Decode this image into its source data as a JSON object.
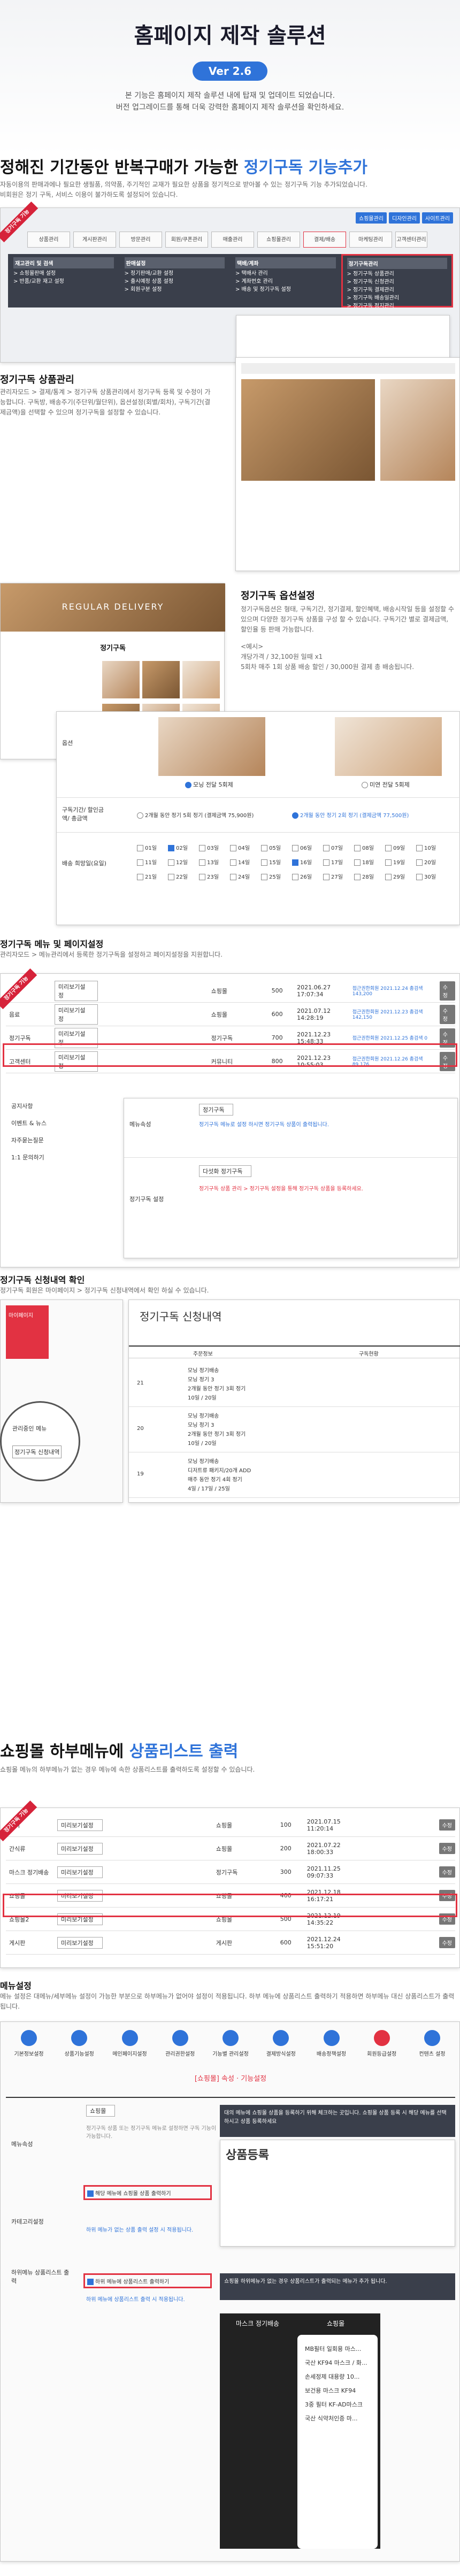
{
  "header": {
    "title": "홈페이지 제작 솔루션",
    "version": "Ver 2.6",
    "intro_lines": [
      "본 기능은 홈페이지 제작 솔루션 내에 탑재 및 업데이트 되었습니다.",
      "버전 업그레이드를 통해 더욱 강력한 홈페이지 제작 솔루션을 확인하세요."
    ]
  },
  "s1": {
    "title_a": "정해진 기간동안 반복구매가 가능한 ",
    "title_b": "정기구독 기능추가",
    "desc1": "자동이용의 판매과에나 필요한 생필품, 의약품, 주기적인 교재가 필요한 상품을 정기적으로 받아볼 수 있는 정기구독 기능 추가되었습니다.",
    "desc2": "비회원은 정기 구독, 서비스 이용이 불가하도록 설정되어 있습니다.",
    "top_links": [
      "쇼핑몰관리",
      "디자인관리",
      "사이트관리"
    ],
    "tabs": [
      "상품관리",
      "게시판관리",
      "방문관리",
      "회원/쿠폰관리",
      "매출관리",
      "쇼핑몰관리",
      "결제/배송",
      "마케팅관리",
      "고객센터관리"
    ],
    "menu_cols": [
      {
        "head": "재고관리 및 검색",
        "items": [
          "> 쇼핑몰판매 설정",
          "> 반품/교환 재고 설정"
        ]
      },
      {
        "head": "판매설정",
        "items": [
          "> 정기판매/교환 설정",
          "> 출시예정 상품 설정",
          "> 회원구분 설정"
        ]
      },
      {
        "head": "택배/계좌",
        "items": [
          "> 택배사 관리",
          "> 계좌번호 관리",
          "> 배송 및 정기구독 설정"
        ]
      },
      {
        "head": "정기구독관리",
        "items": [
          "> 정기구독 상품관리",
          "> 정기구독 신청관리",
          "> 정기구독 결제관리",
          "> 정기구독 배송일관리",
          "> 정기구독 정지관리"
        ]
      }
    ],
    "badge": "정기구독 기능",
    "manage_title": "정기구독 상품관리",
    "manage_desc": "관리자모드 > 결제/통계 > 정기구독 상품관리에서 정기구독 등록 및 수정이 가능합니다. 구독방, 배송주기(주단위/월단위), 옵션설정(회별/회차), 구독기간(결제금액)을 선택할 수 있으며 정기구독을 설정할 수 있습니다.",
    "banner_text": "REGULAR DELIVERY",
    "screenshot_title": "정기구독",
    "opt_title": "정기구독 옵션설정",
    "opt_desc": "정기구독옵션은 형태, 구독기간, 정기결제, 할인혜택, 배송시작일 등을 설정할 수 있으며 다양한 정기구독 상품을 구성 할 수 있습니다. 구독기간 별로 결제금액, 할인율 등 판매 가능합니다.",
    "opt_example_h": "<예시>",
    "opt_example_1": "개당가격 / 32,100원 일때 x1",
    "opt_example_2": "5회차 매주 1회 상품 배송 할인 / 30,000원 결제 총 배송됩니다.",
    "option_label": "옵션",
    "option_a": "모닝 전달 5회제",
    "option_b": "미연 전달 5회제",
    "period_label": "구독기간/ 할인금액/ 총금액",
    "period_a": "2개월 동안 정기 5회 정기 (결제금액 75,900원)",
    "period_b": "2개월 동안 정기 2회 정기 (결제금액 77,500원)",
    "ship_label": "배송 희망일(요일)",
    "days": [
      "01일",
      "02일",
      "03일",
      "04일",
      "05일",
      "06일",
      "07일",
      "08일",
      "09일",
      "10일",
      "11일",
      "12일",
      "13일",
      "14일",
      "15일",
      "16일",
      "17일",
      "18일",
      "19일",
      "20일",
      "21일",
      "22일",
      "23일",
      "24일",
      "25일",
      "26일",
      "27일",
      "28일",
      "29일",
      "30일"
    ]
  },
  "s2": {
    "title": "정기구독 메뉴 및 페이지설정",
    "desc": "관리자모드 > 메뉴관리에서 등록한 정기구독을 설정하고 페이지설정을 지원합니다.",
    "rows": [
      {
        "name": "상품",
        "type": "쇼핑몰",
        "code": "500",
        "date": "2021.06.27 17:07:34",
        "status": "접근권한회원 2021.12.24 총검색 143,200"
      },
      {
        "name": "음료",
        "type": "쇼핑몰",
        "code": "600",
        "date": "2021.07.12 14:28:19",
        "status": "접근권한회원 2021.12.23 총검색 142,150"
      },
      {
        "name": "정기구독",
        "type": "정기구독",
        "code": "700",
        "date": "2021.12.23 15:48:33",
        "status": "접근권한회원 2021.12.25 총검색 0"
      },
      {
        "name": "고객센터",
        "type": "커뮤니티",
        "code": "800",
        "date": "2021.12.23 10:55:03",
        "status": "접근권한회원 2021.12.26 총검색 89,176"
      }
    ],
    "sub_rows": [
      "공지사항",
      "이벤트 & 뉴스",
      "자주묻는질문",
      "1:1 문의하기"
    ],
    "select_label": "미리보기설정",
    "edit_btn": "수정",
    "menu_attr": "메뉴속성",
    "menu_attr_val": "정기구독",
    "menu_note": "정기구독 메뉴로 설정 하시면 정기구독 상품이 출력됩니다.",
    "sub_setting": "정기구독 설정",
    "sub_select": "다섯화 정기구독",
    "sub_note": "정기구독 상품 관리 > 정기구독 설정을 통해 정기구독 상품을 등록하세요."
  },
  "s3": {
    "title": "정기구독 신청내역 확인",
    "desc": "정기구독 회원은 마이페이지 > 정기구독 신청내역에서 확인 하실 수 있습니다.",
    "mypage": "마이페이지",
    "mypage_items": [
      "관리중인 메뉴",
      "정기구독 신청내역"
    ],
    "list_title": "정기구독 신청내역",
    "col_info": "주문정보",
    "col_status": "구독현황",
    "orders": [
      {
        "no": "21",
        "name": "모닝 정기배송",
        "opt": "모닝 정기 3",
        "period": "2개월 동안 정기 3회 정기",
        "day": "10일 / 20일"
      },
      {
        "no": "20",
        "name": "모닝 정기배송",
        "opt": "모닝 정기 3",
        "period": "2개월 동안 정기 3회 정기",
        "day": "10일 / 20일"
      },
      {
        "no": "19",
        "name": "모닝 정기배송",
        "opt": "디저트류 패키지/20개 ADD",
        "period": "매주 동안 정기 4회 정기",
        "day": "4일 / 17일 / 25일"
      }
    ]
  },
  "s4": {
    "title_a": "쇼핑몰 하부메뉴에 ",
    "title_b": "상품리스트 출력",
    "desc": "쇼핑몰 메뉴의 하부메뉴가 없는 경우 메뉴에 속한 상품리스트를 출력하도록 설정할 수 있습니다.",
    "rows": [
      {
        "name": "커피",
        "type": "쇼핑몰",
        "code": "100",
        "date": "2021.07.15 11:20:14"
      },
      {
        "name": "간식류",
        "type": "쇼핑몰",
        "code": "200",
        "date": "2021.07.22 18:00:33"
      },
      {
        "name": "마스크 정기배송",
        "type": "정기구독",
        "code": "300",
        "date": "2021.11.25 09:07:33"
      },
      {
        "name": "쇼핑몰",
        "type": "쇼핑몰",
        "code": "400",
        "date": "2021.12.18 16:17:21"
      },
      {
        "name": "쇼핑몰2",
        "type": "쇼핑몰",
        "code": "500",
        "date": "2021.12.19 14:35:22"
      },
      {
        "name": "게시판",
        "type": "게시판",
        "code": "600",
        "date": "2021.12.24 15:51:20"
      }
    ],
    "select_label": "미리보기설정",
    "edit_btn": "수정",
    "setting_h": "메뉴설정",
    "setting_desc": "메뉴 설정은 대메뉴/세부메뉴 설정이 가능한 부분으로 하부메뉴가 없어야 설정이 적용됩니다. 하부 메뉴에 상품리스트 출력하기 적용하면 하부메뉴 대신 상품리스트가 출력 됩니다.",
    "icons": [
      "기본정보설정",
      "상품기능설정",
      "메인페이지설정",
      "관리권한설정",
      "기능별 관리설정",
      "결제방식설정",
      "배송정책설정",
      "회원등급설정",
      "컨텐츠 설정"
    ],
    "panel_title": "[쇼핑몰] 속성 · 기능설정",
    "panel_sub": "쇼핑몰",
    "attr_label": "메뉴속성",
    "attr_note": "정기구독 상품 또는 정기구독 메뉴로 설정하면 구독 기능이 가능합니다.",
    "cat_label": "카테고리설정",
    "cat_check": "해당 메뉴에 쇼핑몰 상품 출력하기",
    "cat_note": "하위 메뉴가 없는 상품 출력 설정 시 적용됩니다.",
    "prod_label": "하위메뉴 상품리스트 출력",
    "prod_check": "하위 메뉴에 상품리스트 출력하기",
    "prod_note": "하위 메뉴에 상품리스트 출력 시 적용됩니다.",
    "tip1": "대의 메뉴에 쇼핑몰 상품을 등록하기 위해 체크하는 곳입니다. 쇼핑몰 상품 등록 시 해당 메뉴를 선택하시고 상품 등록하세요",
    "product_reg": "상품등록",
    "tip2": "쇼핑몰 하위메뉴가 없는 경우 상품리스트가 출력되는 메뉴가 추가 됩니다.",
    "mobile_tab_a": "마스크 정기배송",
    "mobile_tab_b": "쇼핑몰",
    "mobile_items": [
      "MB필터 일회용 마스...",
      "국산 KF94 마스크 / 화...",
      "손세정제 대용량 10...",
      "보건용 마스크 KF94",
      "3중 필터 KF-AD마스크",
      "국산 식약처인증 마..."
    ]
  }
}
